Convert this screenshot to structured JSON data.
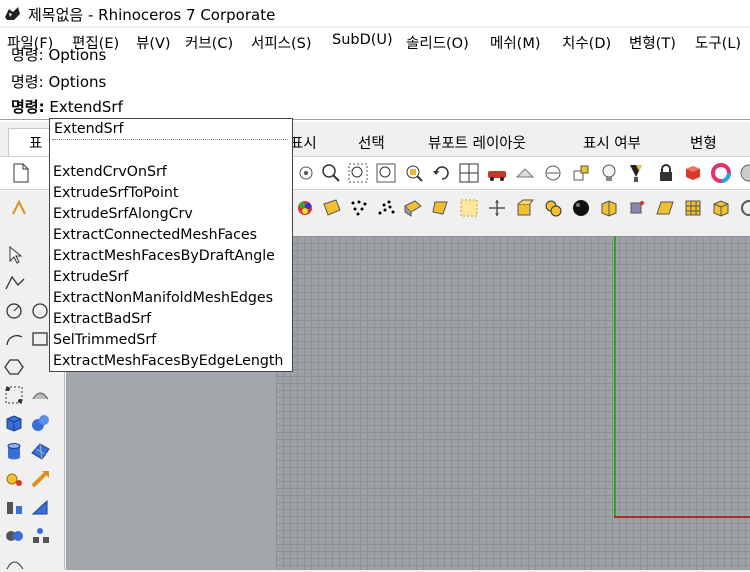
{
  "window": {
    "title": "제목없음 - Rhinoceros 7 Corporate"
  },
  "menu": {
    "items": [
      "파일(F)",
      "편집(E)",
      "뷰(V)",
      "커브(C)",
      "서피스(S)",
      "SubD(U)",
      "솔리드(O)",
      "메쉬(M)",
      "치수(D)",
      "변형(T)",
      "도구(L)"
    ]
  },
  "command_history": {
    "line1_prefix": "명령:",
    "line1_text": "Options",
    "line2_prefix": "명령:",
    "line2_text": "Options"
  },
  "command_prompt": {
    "label": "명령:",
    "value": "ExtendSrf"
  },
  "tabs": {
    "first_partial": "표",
    "items": [
      "표시",
      "선택",
      "뷰포트 레이아웃",
      "표시 여부",
      "변형"
    ]
  },
  "autocomplete": {
    "typed": "ExtendSrf",
    "items": [
      "ExtendCrvOnSrf",
      "ExtrudeSrfToPoint",
      "ExtrudeSrfAlongCrv",
      "ExtractConnectedMeshFaces",
      "ExtractMeshFacesByDraftAngle",
      "ExtrudeSrf",
      "ExtractNonManifoldMeshEdges",
      "ExtractBadSrf",
      "SelTrimmedSrf",
      "ExtractMeshFacesByEdgeLength"
    ]
  },
  "colors": {
    "axis_y": "#2aa52a",
    "axis_x": "#b02a2a",
    "viewport_bg": "#a0a4a8"
  }
}
